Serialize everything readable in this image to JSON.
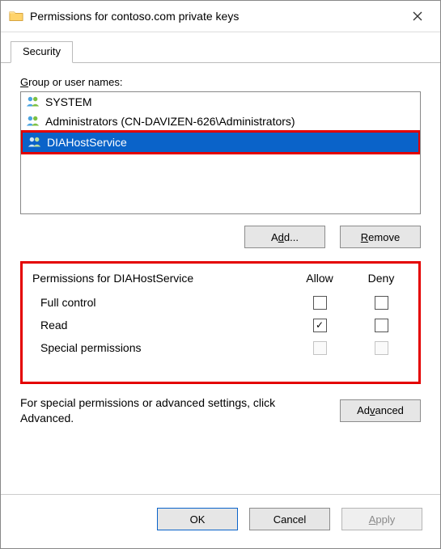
{
  "title": "Permissions for contoso.com private keys",
  "tabs": {
    "security": "Security"
  },
  "group_label_pre": "G",
  "group_label_mid": "roup or user names:",
  "users": [
    {
      "label": "SYSTEM",
      "selected": false
    },
    {
      "label": "Administrators (CN-DAVIZEN-626\\Administrators)",
      "selected": false
    },
    {
      "label": "DIAHostService",
      "selected": true
    }
  ],
  "buttons": {
    "add_pre": "A",
    "add_uchar": "d",
    "add_post": "d...",
    "remove_pre": "",
    "remove_uchar": "R",
    "remove_post": "emove",
    "advanced_pre": "Ad",
    "advanced_uchar": "v",
    "advanced_post": "anced",
    "ok": "OK",
    "cancel": "Cancel",
    "apply_pre": "",
    "apply_uchar": "A",
    "apply_post": "pply"
  },
  "perm_title": "Permissions for DIAHostService",
  "col_allow": "Allow",
  "col_deny": "Deny",
  "perms": [
    {
      "name": "Full control",
      "allow": false,
      "deny": false,
      "disabled": false
    },
    {
      "name": "Read",
      "allow": true,
      "deny": false,
      "disabled": false
    },
    {
      "name": "Special permissions",
      "allow": false,
      "deny": false,
      "disabled": true
    }
  ],
  "adv_text": "For special permissions or advanced settings, click Advanced."
}
